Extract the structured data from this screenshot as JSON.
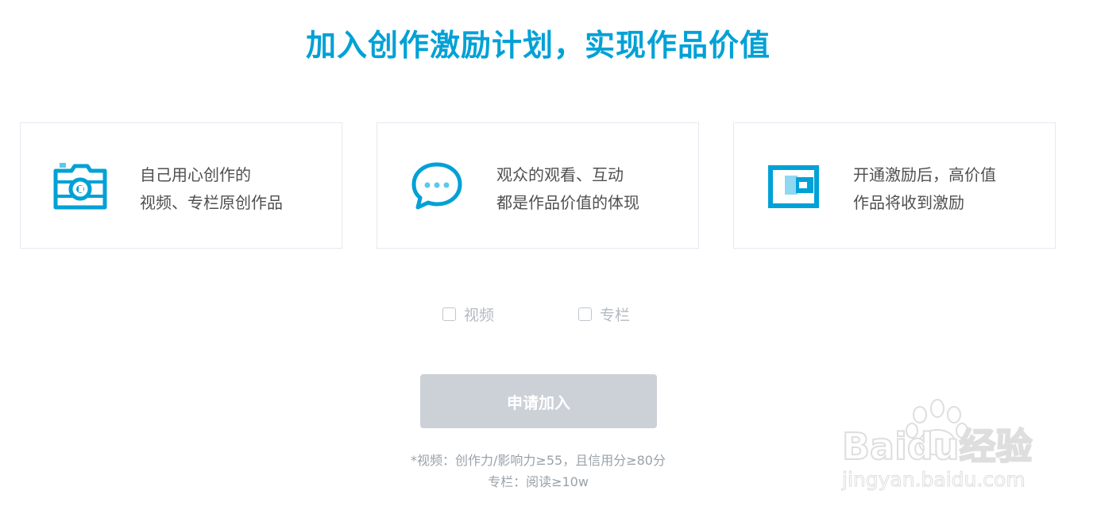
{
  "headline": "加入创作激励计划，实现作品价值",
  "colors": {
    "accent": "#00a1d6",
    "card_border": "#e5e9ef",
    "body_text": "#505050",
    "disabled_button": "#ccd0d7",
    "muted_text": "#99a2aa"
  },
  "cards": [
    {
      "icon": "camera-icon",
      "line1": "自己用心创作的",
      "line2": "视频、专栏原创作品"
    },
    {
      "icon": "chat-bubble-icon",
      "line1": "观众的观看、互动",
      "line2": "都是作品价值的体现"
    },
    {
      "icon": "wallet-icon",
      "line1": "开通激励后，高价值",
      "line2": "作品将收到激励"
    }
  ],
  "options": [
    {
      "label": "视频",
      "checked": false
    },
    {
      "label": "专栏",
      "checked": false
    }
  ],
  "apply_button": {
    "label": "申请加入",
    "enabled": false
  },
  "notes": {
    "video": "*视频：创作力/影响力≥55，且信用分≥80分",
    "column": "专栏：阅读≥10w"
  },
  "watermark": {
    "brand": "Baidu经验",
    "url": "jingyan.baidu.com"
  }
}
